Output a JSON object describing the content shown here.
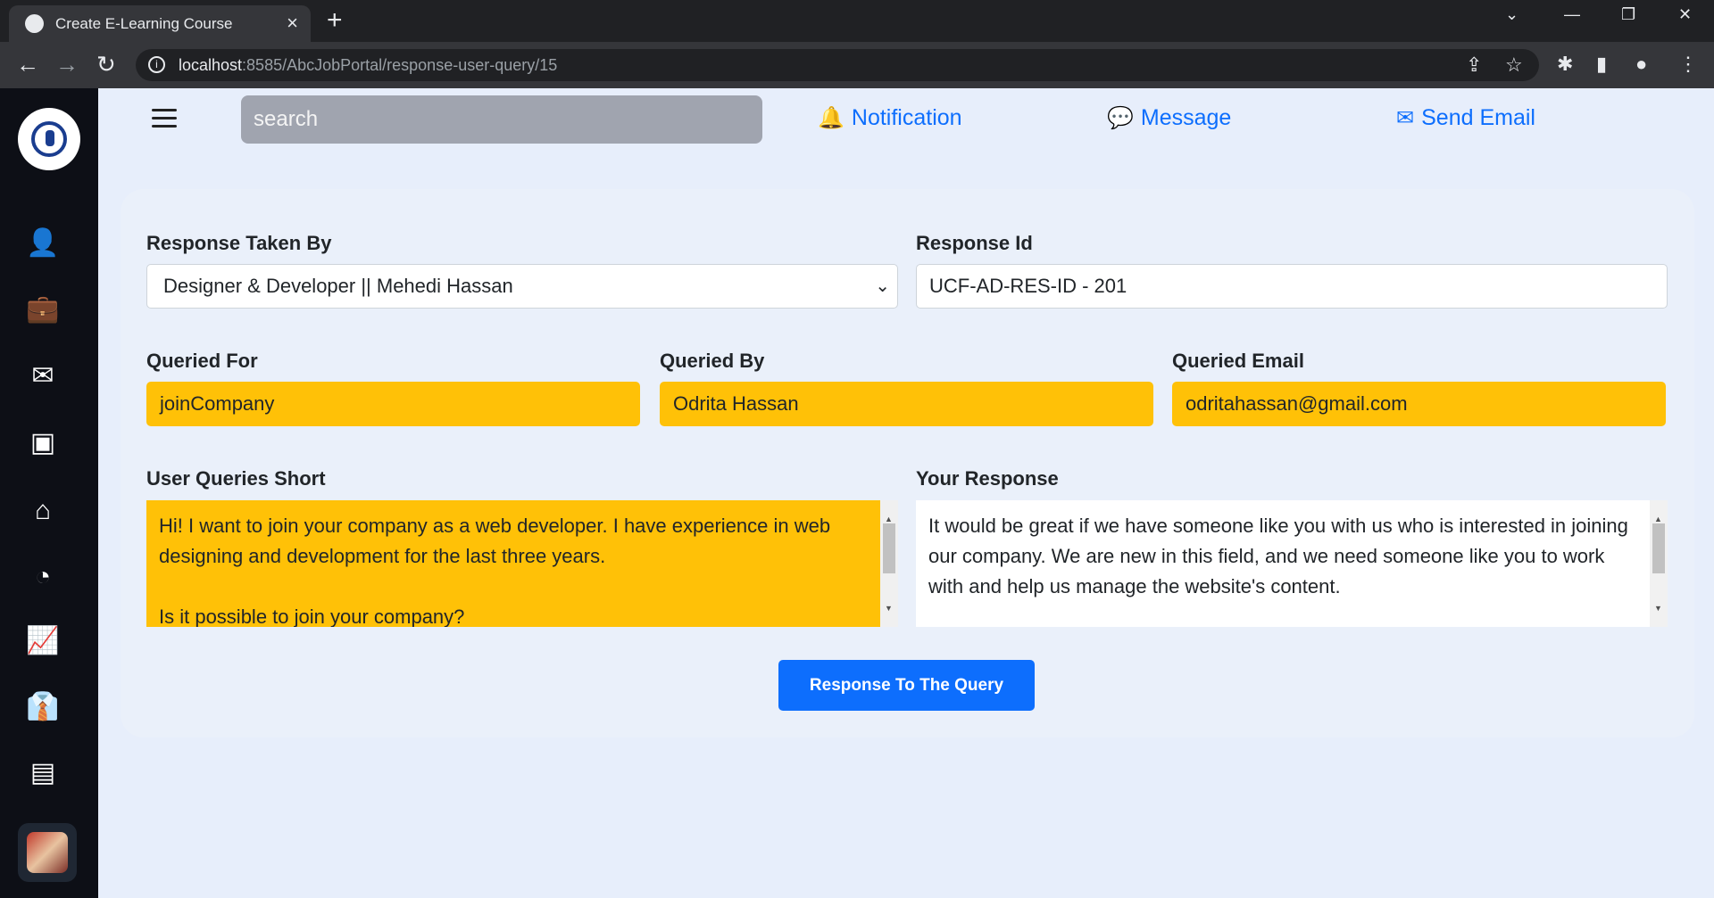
{
  "browser": {
    "tab_title": "Create E-Learning Course",
    "url_host": "localhost",
    "url_rest": ":8585/AbcJobPortal/response-user-query/15"
  },
  "topbar": {
    "search_placeholder": "search",
    "notification": "Notification",
    "message": "Message",
    "send_email": "Send Email"
  },
  "form": {
    "response_taken_by_label": "Response Taken By",
    "response_taken_by_value": "Designer & Developer || Mehedi Hassan",
    "response_id_label": "Response Id",
    "response_id_value": "UCF-AD-RES-ID - 201",
    "queried_for_label": "Queried For",
    "queried_for_value": "joinCompany",
    "queried_by_label": "Queried By",
    "queried_by_value": "Odrita Hassan",
    "queried_email_label": "Queried Email",
    "queried_email_value": "odritahassan@gmail.com",
    "user_queries_label": "User Queries Short",
    "user_queries_p1": "Hi! I want to join your company as a web developer. I have experience in web designing and development for the last three years.",
    "user_queries_p2": "Is it possible to join your company?",
    "your_response_label": "Your Response",
    "your_response_value": "It would be great if we have someone like you with us who is interested in joining our company. We are new in this field, and we need someone like you to work with and help us manage the website's content.",
    "submit_label": "Response To The Query"
  },
  "colors": {
    "accent": "#0d6efd",
    "highlight": "#ffc107",
    "sidebar": "#0d0f16"
  }
}
